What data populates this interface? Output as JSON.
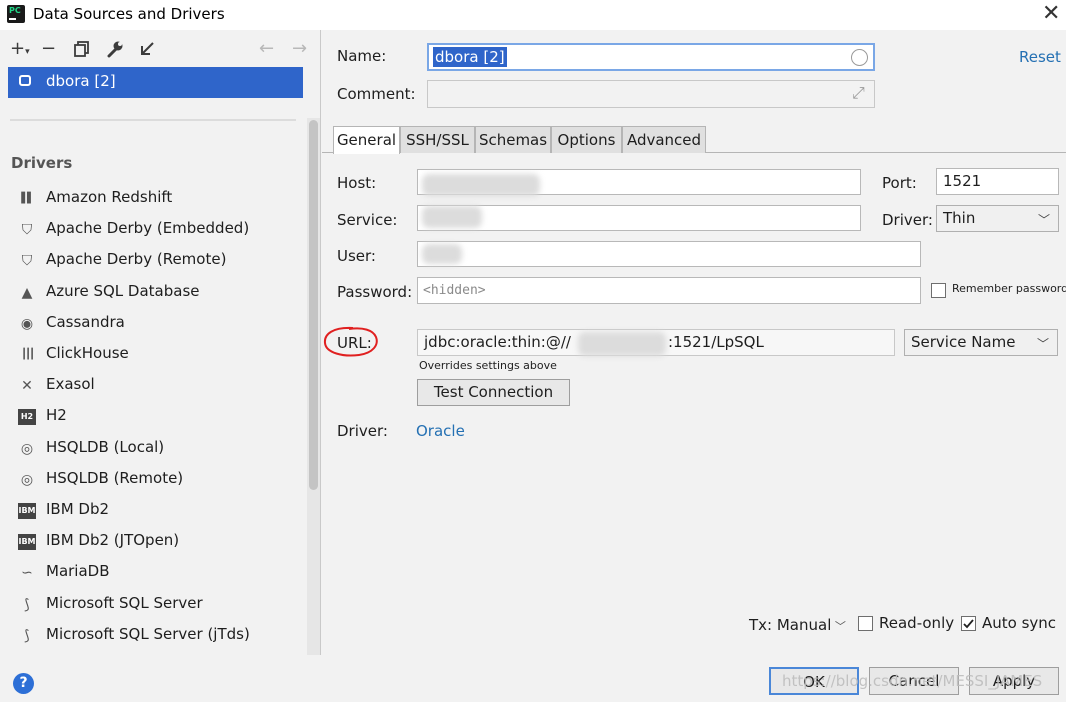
{
  "window": {
    "title": "Data Sources and Drivers",
    "app_icon_text": "PC",
    "close_glyph": "✕"
  },
  "toolbar": {
    "add": "+",
    "add_dropdown": "▾",
    "remove": "−",
    "duplicate_icon": "duplicate-icon",
    "settings_icon": "wrench-icon",
    "import_icon": "import-icon",
    "back": "←",
    "forward": "→"
  },
  "data_sources": [
    {
      "label": "dbora [2]",
      "icon": "oracle-db-icon",
      "selected": true
    }
  ],
  "drivers": {
    "heading": "Drivers",
    "items": [
      {
        "label": "Amazon Redshift",
        "icon": "redshift-icon",
        "glyph": "▌▌"
      },
      {
        "label": "Apache Derby (Embedded)",
        "icon": "derby-hat-icon",
        "glyph": "⛉"
      },
      {
        "label": "Apache Derby (Remote)",
        "icon": "derby-hat-icon",
        "glyph": "⛉"
      },
      {
        "label": "Azure SQL Database",
        "icon": "azure-icon",
        "glyph": "▲"
      },
      {
        "label": "Cassandra",
        "icon": "cassandra-eye-icon",
        "glyph": "◉"
      },
      {
        "label": "ClickHouse",
        "icon": "clickhouse-icon",
        "glyph": "┃┃┃"
      },
      {
        "label": "Exasol",
        "icon": "exasol-x-icon",
        "glyph": "✕"
      },
      {
        "label": "H2",
        "icon": "h2-icon",
        "glyph": "H2"
      },
      {
        "label": "HSQLDB (Local)",
        "icon": "hsqldb-icon",
        "glyph": "◎"
      },
      {
        "label": "HSQLDB (Remote)",
        "icon": "hsqldb-icon",
        "glyph": "◎"
      },
      {
        "label": "IBM Db2",
        "icon": "ibm-db2-icon",
        "glyph": "IBM"
      },
      {
        "label": "IBM Db2 (JTOpen)",
        "icon": "ibm-db2-icon",
        "glyph": "IBM"
      },
      {
        "label": "MariaDB",
        "icon": "mariadb-seal-icon",
        "glyph": "∽"
      },
      {
        "label": "Microsoft SQL Server",
        "icon": "mssql-icon",
        "glyph": "⟆"
      },
      {
        "label": "Microsoft SQL Server (jTds)",
        "icon": "mssql-icon",
        "glyph": "⟆"
      }
    ]
  },
  "form": {
    "name_label": "Name:",
    "name_value": "dbora [2]",
    "reset_label": "Reset",
    "comment_label": "Comment:",
    "comment_value": "",
    "expand_glyph": "⤢",
    "tabs": [
      {
        "label": "General",
        "active": true
      },
      {
        "label": "SSH/SSL",
        "active": false
      },
      {
        "label": "Schemas",
        "active": false
      },
      {
        "label": "Options",
        "active": false
      },
      {
        "label": "Advanced",
        "active": false
      }
    ],
    "host_label": "Host:",
    "port_label": "Port:",
    "port_value": "1521",
    "service_label": "Service:",
    "driver_type_label": "Driver:",
    "driver_type_value": "Thin",
    "user_label": "User:",
    "password_label": "Password:",
    "password_placeholder": "<hidden>",
    "remember_password_label": "Remember password",
    "url_label": "URL:",
    "url_value_prefix": "jdbc:oracle:thin:@//",
    "url_value_suffix": ":1521/LpSQL",
    "url_type_value": "Service Name",
    "url_hint": "Overrides settings above",
    "test_connection_label": "Test Connection",
    "driver_label": "Driver:",
    "driver_link": "Oracle",
    "tx_label": "Tx: Manual",
    "readonly_label": "Read-only",
    "readonly_checked": false,
    "autosync_label": "Auto sync",
    "autosync_checked": true
  },
  "footer": {
    "help": "?",
    "ok_label": "OK",
    "cancel_label": "Cancel",
    "apply_label": "Apply",
    "watermark": "https://blog.csdn.net/MESSI_JAMES"
  },
  "colors": {
    "selection": "#2f65ca",
    "link": "#2470b3",
    "annotation_red": "#e02020"
  }
}
